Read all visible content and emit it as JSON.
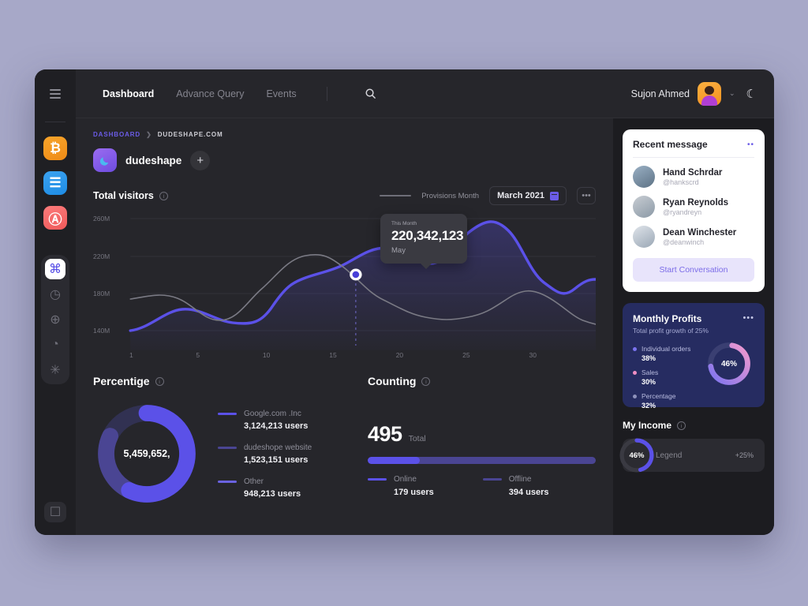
{
  "window": {
    "background_color": "#a7a8c8",
    "surface_color": "#26262b",
    "accent_color": "#5b51e8"
  },
  "rail": {
    "menu_icon": "hamburger-icon",
    "apps": [
      {
        "name": "bitcoin-app",
        "glyph": "₿",
        "color": "#f7a42b"
      },
      {
        "name": "list-app",
        "glyph": "☰",
        "color": "#3ba2f0"
      },
      {
        "name": "airbnb-app",
        "glyph": "Ⓐ",
        "color": "#fb7b7b"
      }
    ],
    "tools": [
      {
        "name": "command-tool",
        "glyph": "⌘",
        "active": true
      },
      {
        "name": "clock-tool",
        "glyph": "◷",
        "active": false
      },
      {
        "name": "globe-tool",
        "glyph": "⊕",
        "active": false
      },
      {
        "name": "pie-tool",
        "glyph": "◔",
        "active": false
      },
      {
        "name": "sparkle-tool",
        "glyph": "✳",
        "active": false
      }
    ],
    "bottom_tool": {
      "name": "chat-tool",
      "glyph": "☐"
    }
  },
  "topnav": {
    "items": [
      {
        "label": "Dashboard",
        "active": true
      },
      {
        "label": "Advance Query",
        "active": false
      },
      {
        "label": "Events",
        "active": false
      }
    ],
    "search_icon": "search-icon",
    "user_name": "Sujon Ahmed",
    "chevron": "⌄",
    "theme_icon": "☾"
  },
  "breadcrumb": {
    "root": "DASHBOARD",
    "separator": "❯",
    "current": "DUDESHAPE.COM"
  },
  "site": {
    "name": "dudeshape",
    "add_label": "+"
  },
  "visitors": {
    "title": "Total visitors",
    "info": "i",
    "legend_label": "Provisions Month",
    "date_value": "March 2021",
    "menu_label": "•••",
    "tooltip": {
      "caption": "This Month",
      "value": "220,342,123",
      "month": "May"
    }
  },
  "percentige": {
    "title": "Percentige",
    "info": "i",
    "center_value": "5,459,652,",
    "items": [
      {
        "label": "Google.com .Inc",
        "value": "3,124,213 users",
        "color": "#5b51e8",
        "share": 57
      },
      {
        "label": "dudeshope website",
        "value": "1,523,151 users",
        "color": "#4a4593",
        "share": 25
      },
      {
        "label": "Other",
        "value": "948,213 users",
        "color": "#313152",
        "share": 18
      }
    ]
  },
  "counting": {
    "title": "Counting",
    "info": "i",
    "total_value": "495",
    "total_label": "Total",
    "progress_percent": 23,
    "items": [
      {
        "label": "Online",
        "value": "179 users",
        "color": "#5b51e8"
      },
      {
        "label": "Offline",
        "value": "394 users",
        "color": "#4a4593"
      }
    ]
  },
  "recent_message": {
    "title": "Recent message",
    "menu_label": "••",
    "people": [
      {
        "name": "Hand Schrdar",
        "handle": "@hankscrd"
      },
      {
        "name": "Ryan Reynolds",
        "handle": "@ryandreyn"
      },
      {
        "name": "Dean Winchester",
        "handle": "@deanwinch"
      }
    ],
    "cta": "Start Conversation"
  },
  "monthly_profits": {
    "title": "Monthly Profits",
    "subtitle": "Total profit growth of 25%",
    "menu_label": "•••",
    "donut_value": "46%",
    "items": [
      {
        "label": "Individual orders",
        "value": "38%",
        "color": "#7b74f0"
      },
      {
        "label": "Sales",
        "value": "30%",
        "color": "#ef8fc4"
      },
      {
        "label": "Percentage",
        "value": "32%",
        "color": "#8e92bb"
      }
    ]
  },
  "my_income": {
    "title": "My Income",
    "info": "i",
    "donut_value": "46%",
    "legend_label": "Legend",
    "delta": "+25%"
  },
  "chart_data": {
    "type": "line",
    "title": "Total visitors",
    "xlabel": "",
    "ylabel": "",
    "x": [
      1,
      5,
      10,
      15,
      20,
      25,
      30
    ],
    "xtick_labels": [
      "1",
      "5",
      "10",
      "15",
      "20",
      "25",
      "30"
    ],
    "ytick_labels": [
      "260M",
      "220M",
      "180M",
      "140M"
    ],
    "ylim": [
      140,
      280
    ],
    "grid": true,
    "legend_position": "top-right",
    "highlight_point": {
      "x": 13,
      "value": "220,342,123",
      "label": "May",
      "caption": "This Month"
    },
    "series": [
      {
        "name": "This Month",
        "color": "#5b51e8",
        "area_fill": true,
        "points": [
          [
            1,
            148
          ],
          [
            3,
            158
          ],
          [
            5,
            168
          ],
          [
            7,
            163
          ],
          [
            9,
            152
          ],
          [
            11,
            175
          ],
          [
            13,
            205
          ],
          [
            15,
            240
          ],
          [
            17,
            243
          ],
          [
            19,
            228
          ],
          [
            21,
            243
          ],
          [
            23,
            258
          ],
          [
            25,
            250
          ],
          [
            27,
            205
          ],
          [
            28,
            196
          ],
          [
            30,
            208
          ]
        ]
      },
      {
        "name": "Provisions Month",
        "color": "#7a7a84",
        "area_fill": false,
        "points": [
          [
            1,
            182
          ],
          [
            3,
            172
          ],
          [
            5,
            166
          ],
          [
            7,
            178
          ],
          [
            9,
            206
          ],
          [
            11,
            224
          ],
          [
            13,
            218
          ],
          [
            15,
            200
          ],
          [
            17,
            178
          ],
          [
            19,
            163
          ],
          [
            21,
            158
          ],
          [
            23,
            168
          ],
          [
            25,
            185
          ],
          [
            27,
            178
          ],
          [
            30,
            158
          ]
        ]
      }
    ]
  }
}
